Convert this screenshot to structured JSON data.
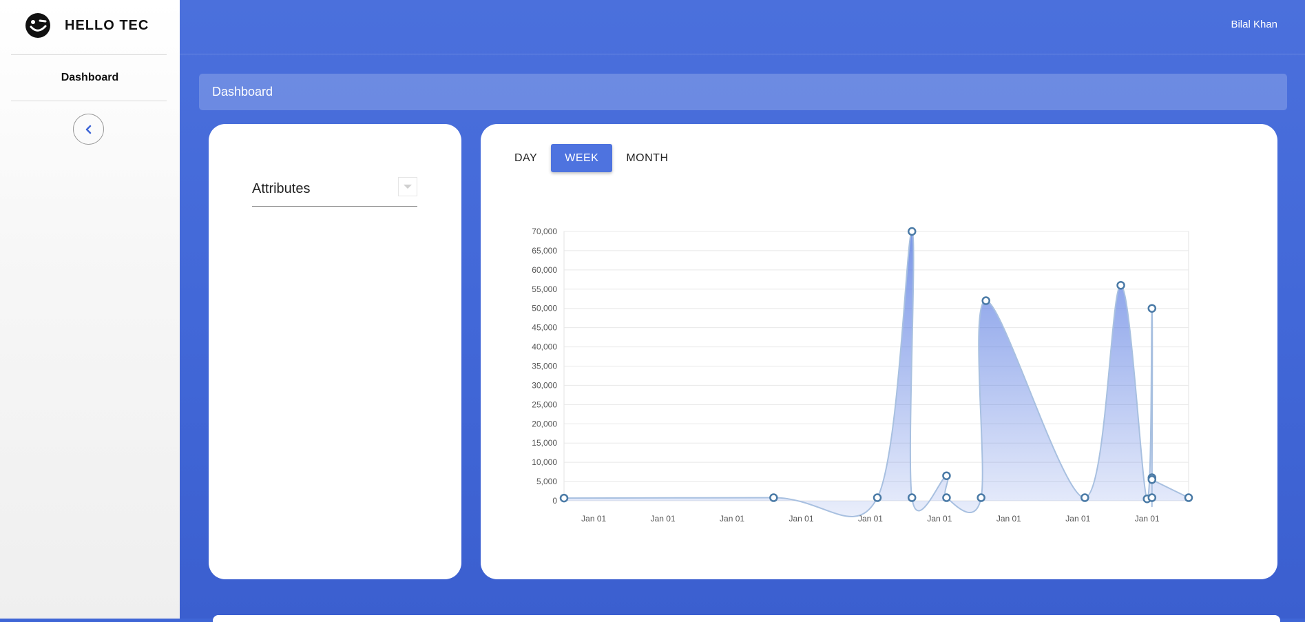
{
  "app": {
    "brand_name": "HELLO TEC",
    "user_name": "Bilal Khan"
  },
  "sidebar": {
    "items": [
      {
        "label": "Dashboard"
      }
    ]
  },
  "breadcrumb": {
    "title": "Dashboard"
  },
  "filters": {
    "attributes_label": "Attributes"
  },
  "tabs": [
    {
      "label": "DAY"
    },
    {
      "label": "WEEK",
      "active": true
    },
    {
      "label": "MONTH"
    }
  ],
  "colors": {
    "accent": "#4e73df",
    "background": "#4268d8",
    "series_line": "#a8c0e0",
    "point_stroke": "#4a7aa6"
  },
  "chart_data": {
    "type": "area",
    "title": "",
    "xlabel": "",
    "ylabel": "",
    "ylim": [
      0,
      70000
    ],
    "y_ticks": [
      "0",
      "5,000",
      "10,000",
      "15,000",
      "20,000",
      "25,000",
      "30,000",
      "35,000",
      "40,000",
      "45,000",
      "50,000",
      "55,000",
      "60,000",
      "65,000",
      "70,000"
    ],
    "x_tick_labels": [
      "Jan 01",
      "Jan 01",
      "Jan 01",
      "Jan 01",
      "Jan 01",
      "Jan 01",
      "Jan 01",
      "Jan 01",
      "Jan 01"
    ],
    "x_tick_positions": [
      0.5,
      1.5,
      2.5,
      3.5,
      4.5,
      5.5,
      6.5,
      7.5,
      8.5
    ],
    "xlim": [
      0.07,
      9.1
    ],
    "grid": true,
    "series": [
      {
        "points": [
          {
            "x": 0.07,
            "y": 700
          },
          {
            "x": 3.1,
            "y": 800
          },
          {
            "x": 4.6,
            "y": 800
          },
          {
            "x": 5.1,
            "y": 70000
          },
          {
            "x": 5.1,
            "y": 800
          },
          {
            "x": 5.6,
            "y": 6500
          },
          {
            "x": 5.6,
            "y": 800
          },
          {
            "x": 6.1,
            "y": 800
          },
          {
            "x": 6.17,
            "y": 52000
          },
          {
            "x": 7.6,
            "y": 800
          },
          {
            "x": 8.12,
            "y": 56000
          },
          {
            "x": 8.5,
            "y": 500
          },
          {
            "x": 8.57,
            "y": 50000
          },
          {
            "x": 8.57,
            "y": 800
          },
          {
            "x": 8.57,
            "y": 6000
          },
          {
            "x": 8.57,
            "y": 5500
          },
          {
            "x": 9.1,
            "y": 800
          }
        ]
      }
    ]
  }
}
